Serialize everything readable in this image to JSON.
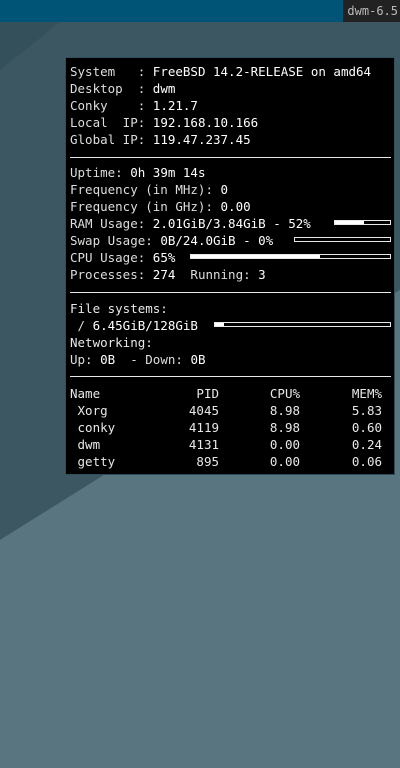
{
  "bar": {
    "status": "dwm-6.5"
  },
  "sys": {
    "system_label": "System   : ",
    "system": "FreeBSD 14.2-RELEASE on amd64",
    "desktop_label": "Desktop  : ",
    "desktop": "dwm",
    "conky_label": "Conky    : ",
    "conky": "1.21.7",
    "lip_label": "Local  IP: ",
    "lip": "192.168.10.166",
    "gip_label": "Global IP: ",
    "gip": "119.47.237.45"
  },
  "stats": {
    "uptime_label": "Uptime: ",
    "uptime": "0h 39m 14s",
    "freq_mhz_label": "Frequency (in MHz): ",
    "freq_mhz": "0",
    "freq_ghz_label": "Frequency (in GHz): ",
    "freq_ghz": "0.00",
    "ram_label": "RAM Usage: ",
    "ram": "2.01GiB/3.84GiB - 52%",
    "ram_fraction": 0.52,
    "swap_label": "Swap Usage: ",
    "swap": "0B/24.0GiB - 0%",
    "swap_fraction": 0.0,
    "cpu_label": "CPU Usage: ",
    "cpu": "65%",
    "cpu_fraction": 0.65,
    "proc_label": "Processes: ",
    "proc": "274",
    "running_label": "  Running: ",
    "running": "3"
  },
  "fs": {
    "title": "File systems:",
    "root_label": " / ",
    "root": "6.45GiB/128GiB",
    "root_fraction": 0.05,
    "net_title": "Networking:",
    "up_label": "Up: ",
    "up": "0B",
    "down_label": "  - Down: ",
    "down": "0B"
  },
  "procs": {
    "headers": [
      "Name",
      "PID",
      "CPU%",
      "MEM%"
    ],
    "rows": [
      {
        "name": " Xorg",
        "pid": "4045",
        "cpu": "8.98",
        "mem": "5.83"
      },
      {
        "name": " conky",
        "pid": "4119",
        "cpu": "8.98",
        "mem": "0.60"
      },
      {
        "name": " dwm",
        "pid": "4131",
        "cpu": "0.00",
        "mem": "0.24"
      },
      {
        "name": " getty",
        "pid": "895",
        "cpu": "0.00",
        "mem": "0.06"
      }
    ]
  },
  "colors": {
    "bar_bg": "#005577",
    "panel_bg": "#000000",
    "text": "#e8e8e8"
  }
}
